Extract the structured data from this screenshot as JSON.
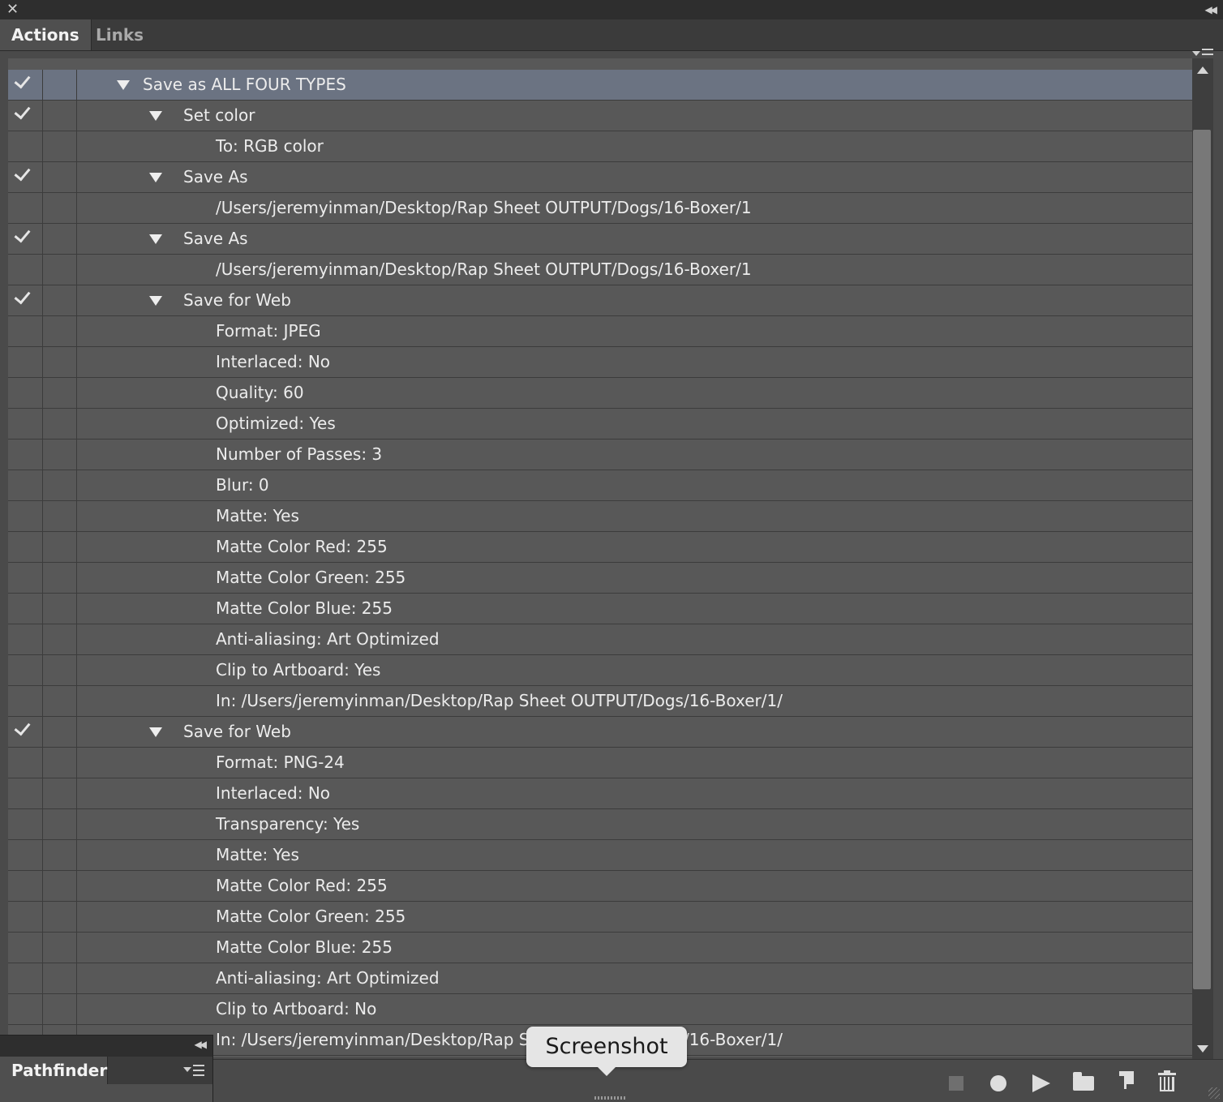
{
  "panel": {
    "tabs": [
      "Actions",
      "Links"
    ],
    "active_tab": "Actions",
    "menu_icon": "panel-menu-icon",
    "close_icon": "close-icon",
    "collapse_icon": "collapse-double-chevron-icon"
  },
  "actions": {
    "rows": [
      {
        "text": "Save as ALL FOUR TYPES",
        "level": 1,
        "expanded": true,
        "checked": true,
        "selected": true
      },
      {
        "text": "Set color",
        "level": 2,
        "expanded": true,
        "checked": true
      },
      {
        "text": "To: RGB color",
        "level": 3,
        "checked": false
      },
      {
        "text": "Save As",
        "level": 2,
        "expanded": true,
        "checked": true
      },
      {
        "text": "/Users/jeremyinman/Desktop/Rap Sheet OUTPUT/Dogs/16-Boxer/1",
        "level": 3,
        "checked": false
      },
      {
        "text": "Save As",
        "level": 2,
        "expanded": true,
        "checked": true
      },
      {
        "text": "/Users/jeremyinman/Desktop/Rap Sheet OUTPUT/Dogs/16-Boxer/1",
        "level": 3,
        "checked": false
      },
      {
        "text": "Save for Web",
        "level": 2,
        "expanded": true,
        "checked": true
      },
      {
        "text": "Format: JPEG",
        "level": 3,
        "checked": false
      },
      {
        "text": "Interlaced: No",
        "level": 3,
        "checked": false
      },
      {
        "text": "Quality: 60",
        "level": 3,
        "checked": false
      },
      {
        "text": "Optimized: Yes",
        "level": 3,
        "checked": false
      },
      {
        "text": "Number of Passes: 3",
        "level": 3,
        "checked": false
      },
      {
        "text": "Blur: 0",
        "level": 3,
        "checked": false
      },
      {
        "text": "Matte: Yes",
        "level": 3,
        "checked": false
      },
      {
        "text": "Matte Color Red: 255",
        "level": 3,
        "checked": false
      },
      {
        "text": "Matte Color Green: 255",
        "level": 3,
        "checked": false
      },
      {
        "text": "Matte Color Blue: 255",
        "level": 3,
        "checked": false
      },
      {
        "text": "Anti-aliasing: Art Optimized",
        "level": 3,
        "checked": false
      },
      {
        "text": "Clip to Artboard: Yes",
        "level": 3,
        "checked": false
      },
      {
        "text": "In: /Users/jeremyinman/Desktop/Rap Sheet OUTPUT/Dogs/16-Boxer/1/",
        "level": 3,
        "checked": false
      },
      {
        "text": "Save for Web",
        "level": 2,
        "expanded": true,
        "checked": true
      },
      {
        "text": "Format: PNG-24",
        "level": 3,
        "checked": false
      },
      {
        "text": "Interlaced: No",
        "level": 3,
        "checked": false
      },
      {
        "text": "Transparency: Yes",
        "level": 3,
        "checked": false
      },
      {
        "text": "Matte: Yes",
        "level": 3,
        "checked": false
      },
      {
        "text": "Matte Color Red: 255",
        "level": 3,
        "checked": false
      },
      {
        "text": "Matte Color Green: 255",
        "level": 3,
        "checked": false
      },
      {
        "text": "Matte Color Blue: 255",
        "level": 3,
        "checked": false
      },
      {
        "text": "Anti-aliasing: Art Optimized",
        "level": 3,
        "checked": false
      },
      {
        "text": "Clip to Artboard: No",
        "level": 3,
        "checked": false
      },
      {
        "text": "In: /Users/jeremyinman/Desktop/Rap Sheet OUTPUT/Dogs/16-Boxer/1/",
        "level": 3,
        "checked": false
      }
    ]
  },
  "toolbar": {
    "buttons": [
      "stop-icon",
      "record-icon",
      "play-icon",
      "new-set-folder-icon",
      "new-action-icon",
      "trash-icon"
    ]
  },
  "pathfinder": {
    "tab_label": "Pathfinder"
  },
  "tooltip": {
    "text": "Screenshot"
  },
  "colors": {
    "selected_row": "#6b7382",
    "row_bg": "#585858",
    "panel_bg": "#4a4a4a"
  }
}
